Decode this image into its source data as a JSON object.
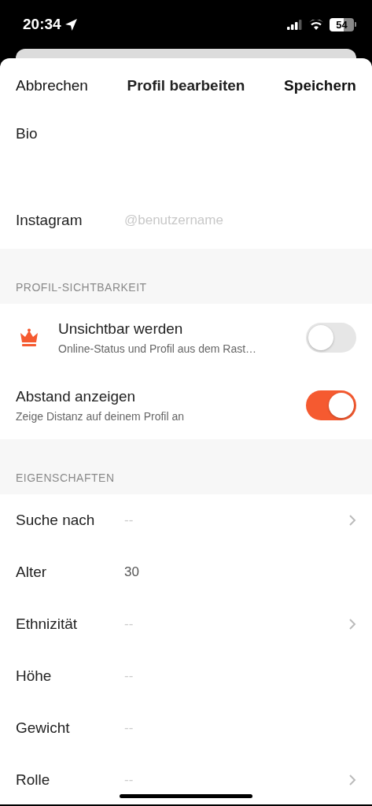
{
  "status_bar": {
    "time": "20:34",
    "battery": "54"
  },
  "nav": {
    "cancel": "Abbrechen",
    "title": "Profil bearbeiten",
    "save": "Speichern"
  },
  "bio": {
    "label": "Bio"
  },
  "instagram": {
    "label": "Instagram",
    "placeholder": "@benutzername"
  },
  "visibility": {
    "header": "PROFIL-SICHTBARKEIT",
    "rows": [
      {
        "kind": "premium",
        "title": "Unsichtbar werden",
        "subtitle": "Online-Status und Profil aus dem Rast…",
        "on": false
      },
      {
        "kind": "plain",
        "title": "Abstand anzeigen",
        "subtitle": "Zeige Distanz auf deinem Profil an",
        "on": true
      }
    ]
  },
  "properties": {
    "header": "EIGENSCHAFTEN",
    "rows": [
      {
        "label": "Suche nach",
        "value": "--",
        "empty": true,
        "chevron": true
      },
      {
        "label": "Alter",
        "value": "30",
        "empty": false,
        "chevron": false
      },
      {
        "label": "Ethnizität",
        "value": "--",
        "empty": true,
        "chevron": true
      },
      {
        "label": "Höhe",
        "value": "--",
        "empty": true,
        "chevron": false
      },
      {
        "label": "Gewicht",
        "value": "--",
        "empty": true,
        "chevron": false
      },
      {
        "label": "Rolle",
        "value": "--",
        "empty": true,
        "chevron": true
      }
    ]
  }
}
